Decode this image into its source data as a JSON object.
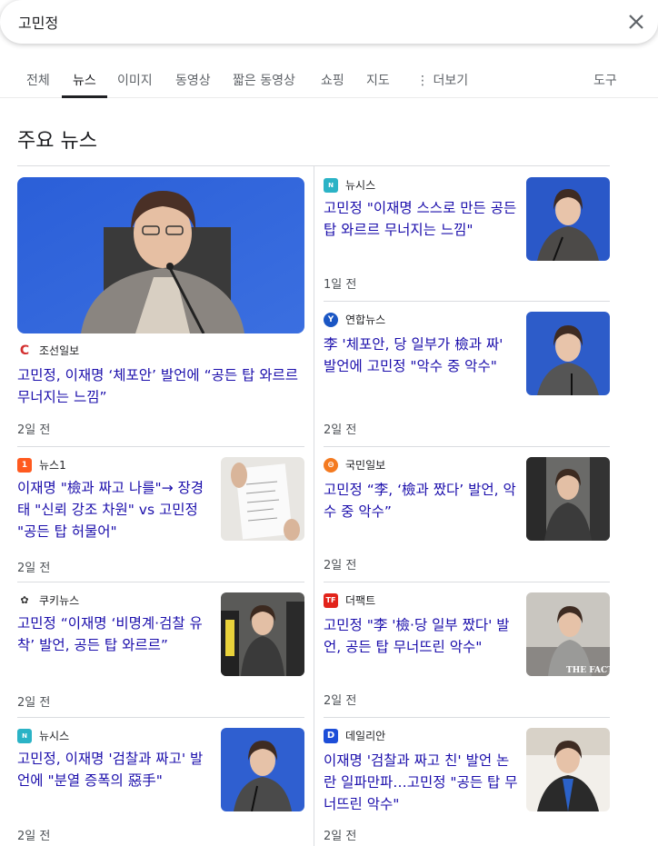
{
  "search": {
    "query": "고민정"
  },
  "tabs": [
    "전체",
    "뉴스",
    "이미지",
    "동영상",
    "짧은 동영상",
    "쇼핑",
    "지도",
    "⋮ 더보기"
  ],
  "tools_label": "도구",
  "section_title": "주요 뉴스",
  "feature": {
    "source": "조선일보",
    "headline": "고민정, 이재명 ‘체포안’ 발언에 “공든 탑 와르르 무너지는 느낌”",
    "age": "2일 전"
  },
  "left": [
    {
      "source": "뉴스1",
      "headline": "이재명 \"檢과 짜고 나를\"→ 장경태 \"신뢰 강조 차원\" vs 고민정 \"공든 탑 허물어\"",
      "age": "2일 전"
    },
    {
      "source": "쿠키뉴스",
      "headline": "고민정 “이재명 ‘비명계·검찰 유착’ 발언, 공든 탑 와르르”",
      "age": "2일 전"
    },
    {
      "source": "뉴시스",
      "headline": "고민정, 이재명 '검찰과 짜고' 발언에 \"분열 증폭의 惡手\"",
      "age": "2일 전"
    }
  ],
  "right": [
    {
      "source": "뉴시스",
      "headline": "고민정 \"이재명 스스로 만든 공든 탑 와르르 무너지는 느낌\"",
      "age": "1일 전"
    },
    {
      "source": "연합뉴스",
      "headline": "李 '체포안, 당 일부가 檢과 짜' 발언에 고민정 \"악수 중 악수\"",
      "age": "2일 전"
    },
    {
      "source": "국민일보",
      "headline": "고민정 “李, ‘檢과 짰다’ 발언, 악수 중 악수”",
      "age": "2일 전"
    },
    {
      "source": "더팩트",
      "headline": "고민정 \"李 '檢·당 일부 짰다' 발언, 공든 탑 무너뜨린 악수\"",
      "age": "2일 전"
    },
    {
      "source": "데일리안",
      "headline": "이재명 '검찰과 짜고 친' 발언 논란 일파만파…고민정 \"공든 탑 무너뜨린 악수\"",
      "age": "2일 전"
    }
  ],
  "thumb_caption_fact": "THE FACT"
}
